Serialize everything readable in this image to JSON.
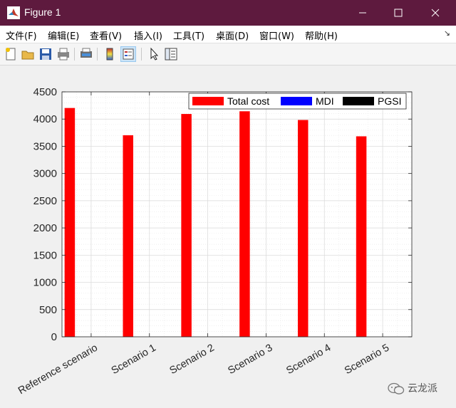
{
  "window": {
    "title": "Figure 1",
    "icons": [
      "matlab-logo-icon",
      "minimize-icon",
      "maximize-icon",
      "close-icon"
    ]
  },
  "menu": {
    "items": [
      "文件(F)",
      "编辑(E)",
      "查看(V)",
      "插入(I)",
      "工具(T)",
      "桌面(D)",
      "窗口(W)",
      "帮助(H)"
    ]
  },
  "toolbar": {
    "icons": [
      "new-figure-icon",
      "open-file-icon",
      "save-icon",
      "print-icon",
      "print-preview-icon",
      "colorbar-icon",
      "legend-icon",
      "pointer-icon",
      "property-editor-icon"
    ]
  },
  "watermark": {
    "text": "云龙派"
  },
  "colors": {
    "titlebar": "#5e1a3e",
    "total_cost": "#ff0000",
    "mdi": "#0000ff",
    "pgsi": "#000000"
  },
  "chart_data": {
    "type": "bar",
    "categories": [
      "Reference scenario",
      "Scenario 1",
      "Scenario 2",
      "Scenario 3",
      "Scenario 4",
      "Scenario 5"
    ],
    "series": [
      {
        "name": "Total cost",
        "values": [
          4200,
          3700,
          4090,
          4140,
          3980,
          3680
        ],
        "color": "#ff0000"
      },
      {
        "name": "MDI",
        "values": [
          0,
          0,
          0,
          0,
          0,
          0
        ],
        "color": "#0000ff"
      },
      {
        "name": "PGSI",
        "values": [
          0,
          0,
          0,
          0,
          0,
          0
        ],
        "color": "#000000"
      }
    ],
    "ylim": [
      0,
      4500
    ],
    "yticks": [
      0,
      500,
      1000,
      1500,
      2000,
      2500,
      3000,
      3500,
      4000,
      4500
    ],
    "title": "",
    "xlabel": "",
    "ylabel": "",
    "grid": true,
    "legend_position": "top-right"
  }
}
